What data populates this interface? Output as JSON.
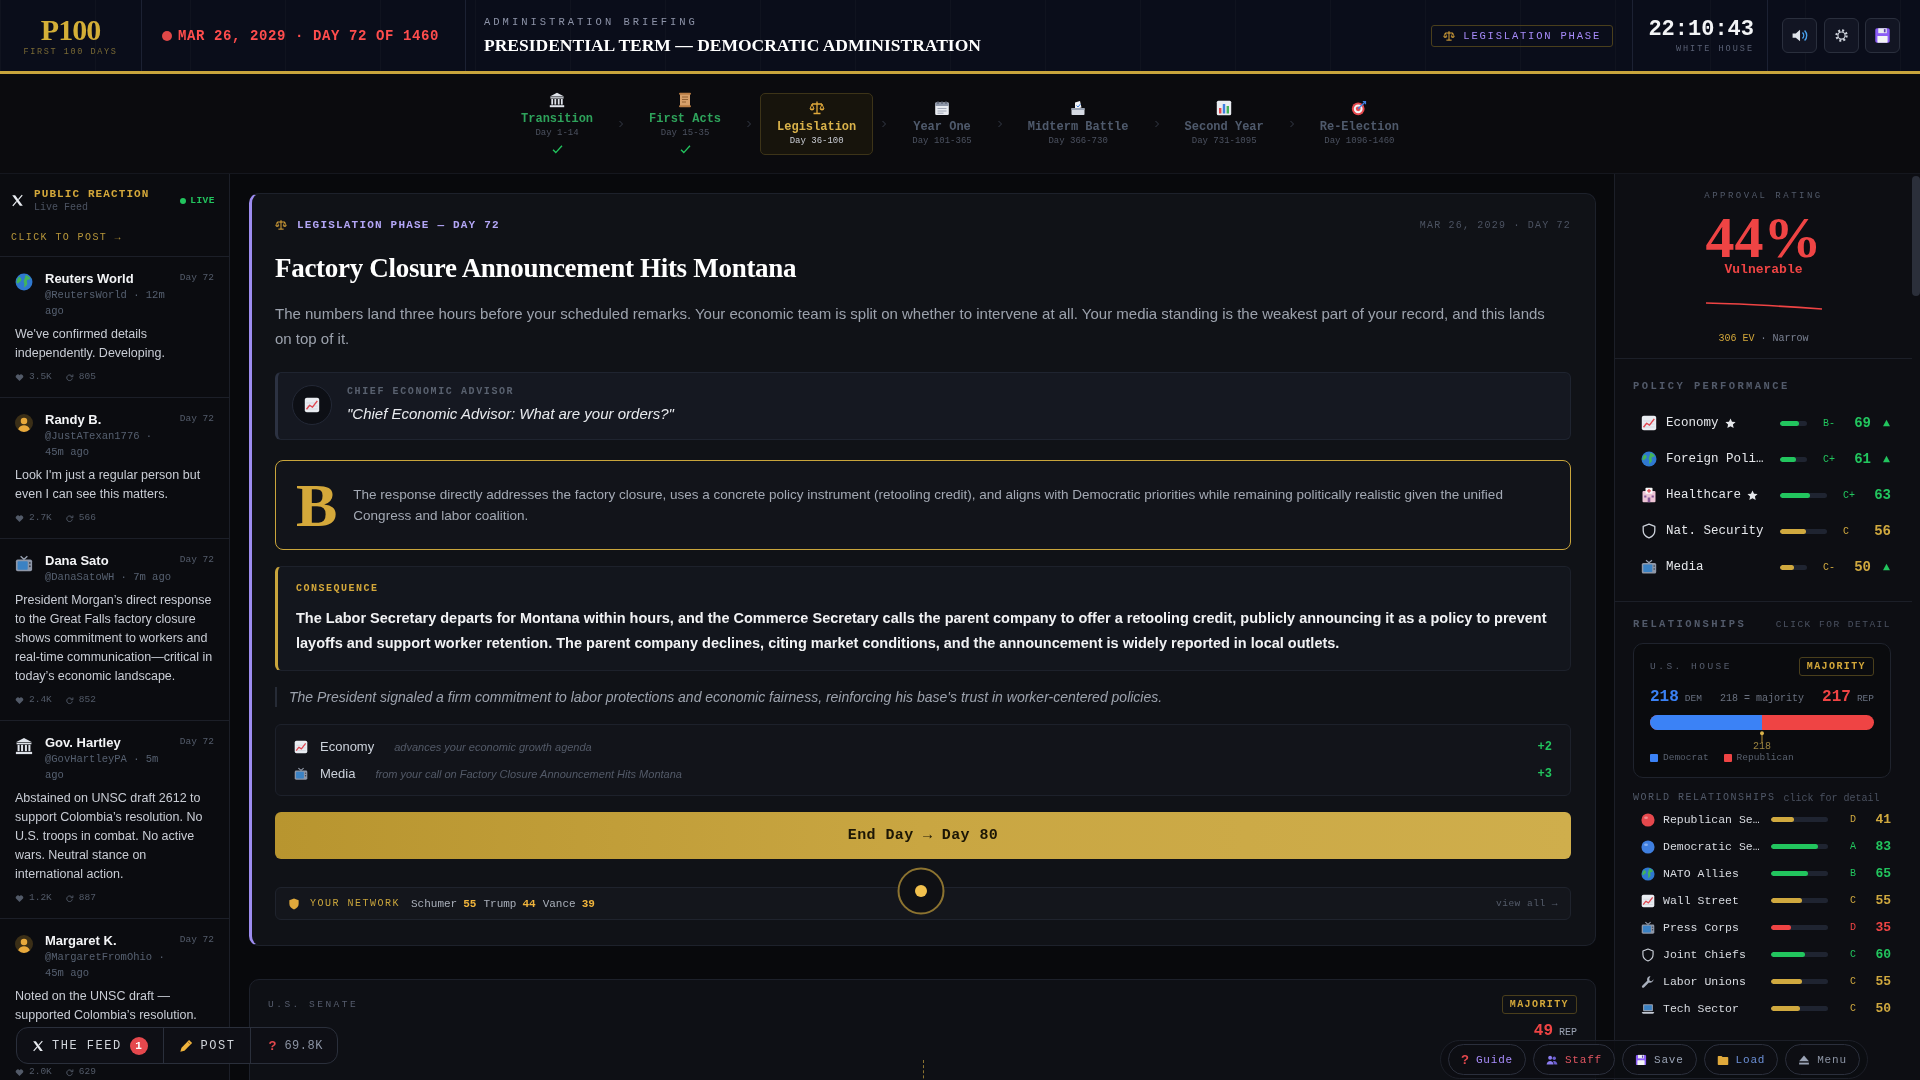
{
  "header": {
    "logo": "P100",
    "tagline": "FIRST 100 DAYS",
    "date": "MAR 26, 2029 · DAY 72 OF 1460",
    "briefing_label": "ADMINISTRATION BRIEFING",
    "briefing_title": "PRESIDENTIAL TERM — DEMOCRATIC ADMINISTRATION",
    "phase_badge": "LEGISLATION PHASE",
    "clock": "22:10:43",
    "clock_location": "WHITE HOUSE"
  },
  "phases": [
    {
      "name": "Transition",
      "days": "Day 1-14",
      "completed": true,
      "selected": false
    },
    {
      "name": "First Acts",
      "days": "Day 15-35",
      "completed": true,
      "selected": false
    },
    {
      "name": "Legislation",
      "days": "Day 36-100",
      "completed": false,
      "selected": true
    },
    {
      "name": "Year One",
      "days": "Day 101-365",
      "completed": false,
      "selected": false
    },
    {
      "name": "Midterm Battle",
      "days": "Day 366-730",
      "completed": false,
      "selected": false
    },
    {
      "name": "Second Year",
      "days": "Day 731-1095",
      "completed": false,
      "selected": false
    },
    {
      "name": "Re-Election",
      "days": "Day 1096-1460",
      "completed": false,
      "selected": false
    }
  ],
  "feed": {
    "title": "PUBLIC REACTION",
    "subtitle": "Live Feed",
    "live": "LIVE",
    "post_link": "CLICK TO POST →",
    "posts": [
      {
        "author": "Reuters World",
        "handle": "@ReutersWorld · 12m ago",
        "day": "Day 72",
        "text": "We've confirmed details independently. Developing.",
        "likes": "3.5K",
        "reposts": "805"
      },
      {
        "author": "Randy B.",
        "handle": "@JustATexan1776 · 45m ago",
        "day": "Day 72",
        "text": "Look I'm just a regular person but even I can see this matters.",
        "likes": "2.7K",
        "reposts": "566"
      },
      {
        "author": "Dana Sato",
        "handle": "@DanaSatoWH · 7m ago",
        "day": "Day 72",
        "text": "President Morgan’s direct response to the Great Falls factory closure shows commitment to workers and real-time communication—critical in today’s economic landscape.",
        "likes": "2.4K",
        "reposts": "852"
      },
      {
        "author": "Gov. Hartley",
        "handle": "@GovHartleyPA · 5m ago",
        "day": "Day 72",
        "text": "Abstained on UNSC draft 2612 to support Colombia’s resolution. No U.S. troops in combat. No active wars. Neutral stance on international action.",
        "likes": "1.2K",
        "reposts": "887"
      },
      {
        "author": "Margaret K.",
        "handle": "@MargaretFromOhio · 45m ago",
        "day": "Day 72",
        "text": "Noted on the UNSC draft — supported Colombia’s resolution.",
        "likes": "2.0K",
        "reposts": "629"
      }
    ]
  },
  "briefing": {
    "phase": "LEGISLATION PHASE — DAY 72",
    "date": "MAR 26, 2029 · DAY 72",
    "title": "Factory Closure Announcement Hits Montana",
    "body": "The numbers land three hours before your scheduled remarks. Your economic team is split on whether to intervene at all. Your media standing is the weakest part of your record, and this lands on top of it.",
    "advisor": {
      "role": "CHIEF ECONOMIC ADVISOR",
      "quote": "\"Chief Economic Advisor: What are your orders?\""
    },
    "grade": {
      "letter": "B",
      "text": "The response directly addresses the factory closure, uses a concrete policy instrument (retooling credit), and aligns with Democratic priorities while remaining politically realistic given the unified Congress and labor coalition."
    },
    "consequence": {
      "label": "CONSEQUENCE",
      "text": "The Labor Secretary departs for Montana within hours, and the Commerce Secretary calls the parent company to offer a retooling credit, publicly announcing it as a policy to prevent layoffs and support worker retention. The parent company declines, citing market conditions, and the announcement is widely reported in local outlets."
    },
    "note": "The President signaled a firm commitment to labor protections and economic fairness, reinforcing his base's trust in worker-centered policies.",
    "effects": [
      {
        "label": "Economy",
        "note": "advances your economic growth agenda",
        "delta": "+2"
      },
      {
        "label": "Media",
        "note": "from your call on Factory Closure Announcement Hits Montana",
        "delta": "+3"
      }
    ],
    "end_day": "End Day → Day 80",
    "network": {
      "label": "YOUR NETWORK",
      "members": [
        {
          "name": "Schumer",
          "score": "55"
        },
        {
          "name": "Trump",
          "score": "44"
        },
        {
          "name": "Vance",
          "score": "39"
        }
      ],
      "link": "view all →"
    }
  },
  "senate": {
    "label": "U.S. SENATE",
    "badge": "MAJORITY",
    "rep_count": "49",
    "rep_label": "REP"
  },
  "approval": {
    "label": "APPROVAL RATING",
    "value": "44%",
    "status": "Vulnerable",
    "ev": "306 EV",
    "margin": "· Narrow"
  },
  "policy": {
    "title": "POLICY PERFORMANCE",
    "rows": [
      {
        "name": "Economy",
        "starred": true,
        "level": 0.69,
        "grade": "B-",
        "value": "69",
        "rising": true
      },
      {
        "name": "Foreign Poli…",
        "starred": false,
        "level": 0.61,
        "grade": "C+",
        "value": "61",
        "rising": true
      },
      {
        "name": "Healthcare",
        "starred": true,
        "level": 0.63,
        "grade": "C+",
        "value": "63",
        "rising": false
      },
      {
        "name": "Nat. Security",
        "starred": false,
        "level": 0.56,
        "grade": "C",
        "value": "56",
        "rising": false
      },
      {
        "name": "Media",
        "starred": false,
        "level": 0.5,
        "grade": "C-",
        "value": "50",
        "rising": true
      }
    ]
  },
  "relationships": {
    "title": "RELATIONSHIPS",
    "hint": "CLICK FOR DETAIL",
    "house": {
      "label": "U.S. HOUSE",
      "badge": "MAJORITY",
      "dem": "218",
      "dem_label": "DEM",
      "threshold": "218 = majority",
      "rep": "217",
      "rep_label": "REP",
      "level": 0.501,
      "marker": "218",
      "legend": [
        "Democrat",
        "Republican"
      ]
    }
  },
  "world": {
    "title": "WORLD RELATIONSHIPS",
    "hint": "click for detail",
    "rows": [
      {
        "name": "Republican Se…",
        "level": 0.41,
        "grade": "D",
        "value": "41"
      },
      {
        "name": "Democratic Se…",
        "level": 0.83,
        "grade": "A",
        "value": "83"
      },
      {
        "name": "NATO Allies",
        "level": 0.65,
        "grade": "B",
        "value": "65"
      },
      {
        "name": "Wall Street",
        "level": 0.55,
        "grade": "C",
        "value": "55"
      },
      {
        "name": "Press Corps",
        "level": 0.35,
        "grade": "D",
        "value": "35"
      },
      {
        "name": "Joint Chiefs",
        "level": 0.6,
        "grade": "C",
        "value": "60"
      },
      {
        "name": "Labor Unions",
        "level": 0.55,
        "grade": "C",
        "value": "55"
      },
      {
        "name": "Tech Sector",
        "level": 0.5,
        "grade": "C",
        "value": "50"
      }
    ]
  },
  "feed_bar": {
    "label": "THE FEED",
    "count": "1",
    "post": "POST",
    "help": "?",
    "score": "69.8K"
  },
  "actions": [
    {
      "label": "Guide",
      "icon": "?"
    },
    {
      "label": "Staff"
    },
    {
      "label": "Save"
    },
    {
      "label": "Load"
    },
    {
      "label": "Menu"
    }
  ]
}
